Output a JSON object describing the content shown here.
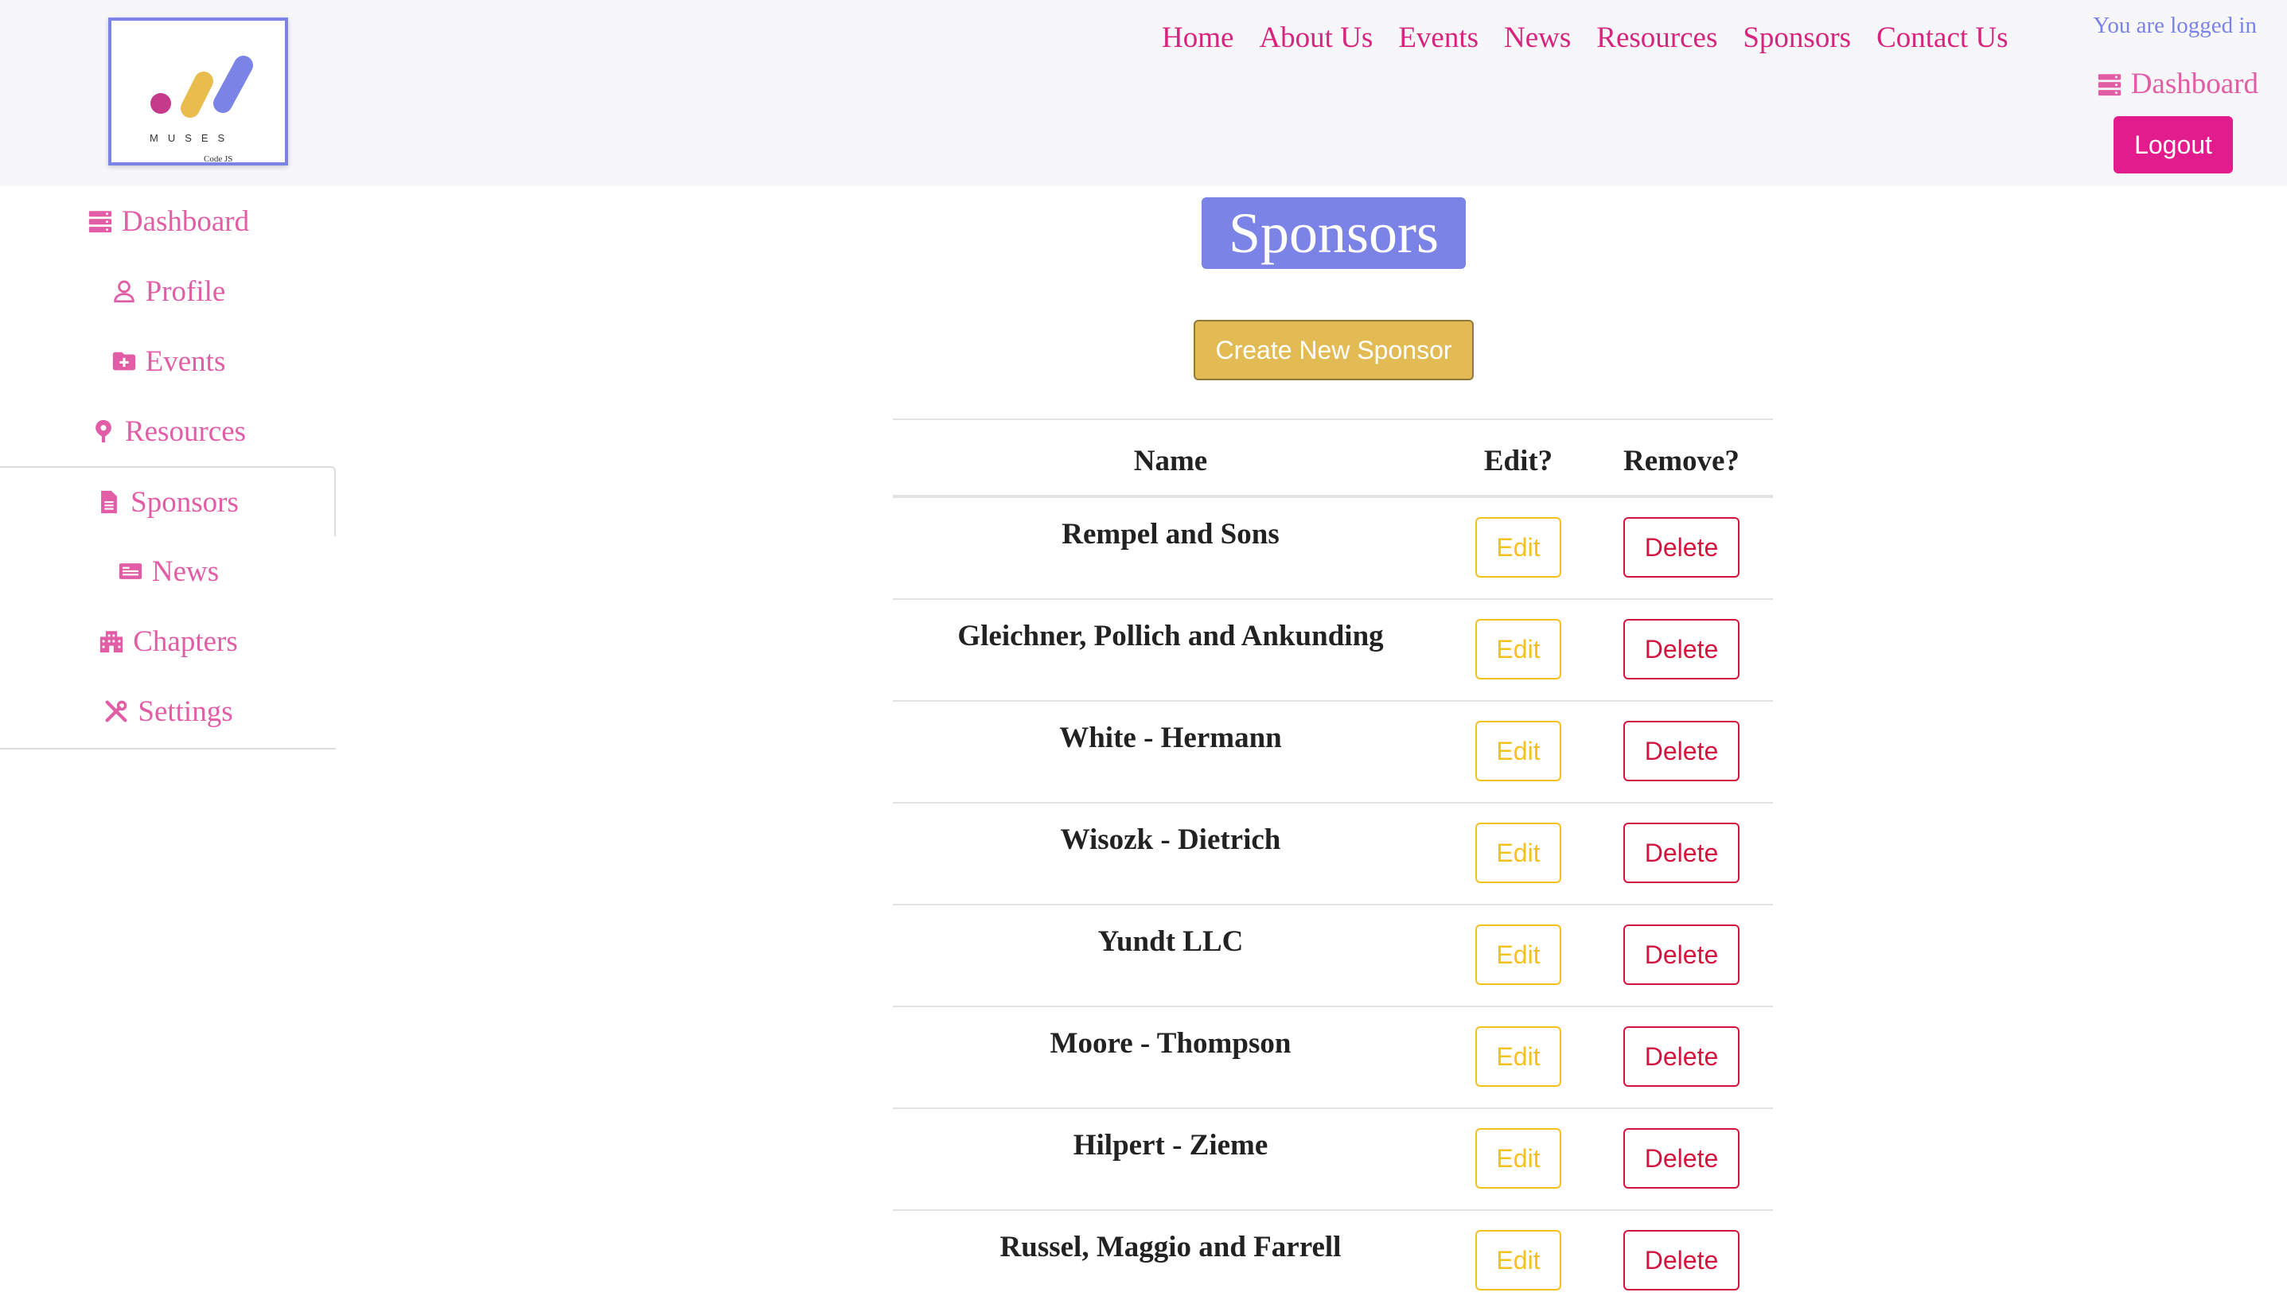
{
  "brand": {
    "logo_text": "MUSES",
    "logo_subtext": "Code JS"
  },
  "topnav": [
    "Home",
    "About Us",
    "Events",
    "News",
    "Resources",
    "Sponsors",
    "Contact Us"
  ],
  "header": {
    "logged_in": "You are logged in",
    "dashboard_label": "Dashboard",
    "logout_label": "Logout"
  },
  "sidebar": {
    "items": [
      {
        "label": "Dashboard",
        "icon": "server-icon"
      },
      {
        "label": "Profile",
        "icon": "user-icon"
      },
      {
        "label": "Events",
        "icon": "folder-plus-icon"
      },
      {
        "label": "Resources",
        "icon": "map-pin-icon"
      },
      {
        "label": "Sponsors",
        "icon": "file-icon",
        "active": true
      },
      {
        "label": "News",
        "icon": "newspaper-icon"
      },
      {
        "label": "Chapters",
        "icon": "building-icon"
      },
      {
        "label": "Settings",
        "icon": "tools-icon"
      }
    ]
  },
  "main": {
    "title": "Sponsors",
    "create_label": "Create New Sponsor",
    "table": {
      "headers": [
        "Name",
        "Edit?",
        "Remove?"
      ],
      "edit_label": "Edit",
      "delete_label": "Delete",
      "rows": [
        "Rempel and Sons",
        "Gleichner, Pollich and Ankunding",
        "White - Hermann",
        "Wisozk - Dietrich",
        "Yundt LLC",
        "Moore - Thompson",
        "Hilpert - Zieme",
        "Russel, Maggio and Farrell"
      ]
    }
  },
  "colors": {
    "accent_pink": "#e31c8d",
    "link_pink": "#d6247f",
    "accent_purple": "#7b83e6",
    "accent_gold": "#e3bb55",
    "edit_yellow": "#f5c11d",
    "delete_red": "#d2153d"
  }
}
